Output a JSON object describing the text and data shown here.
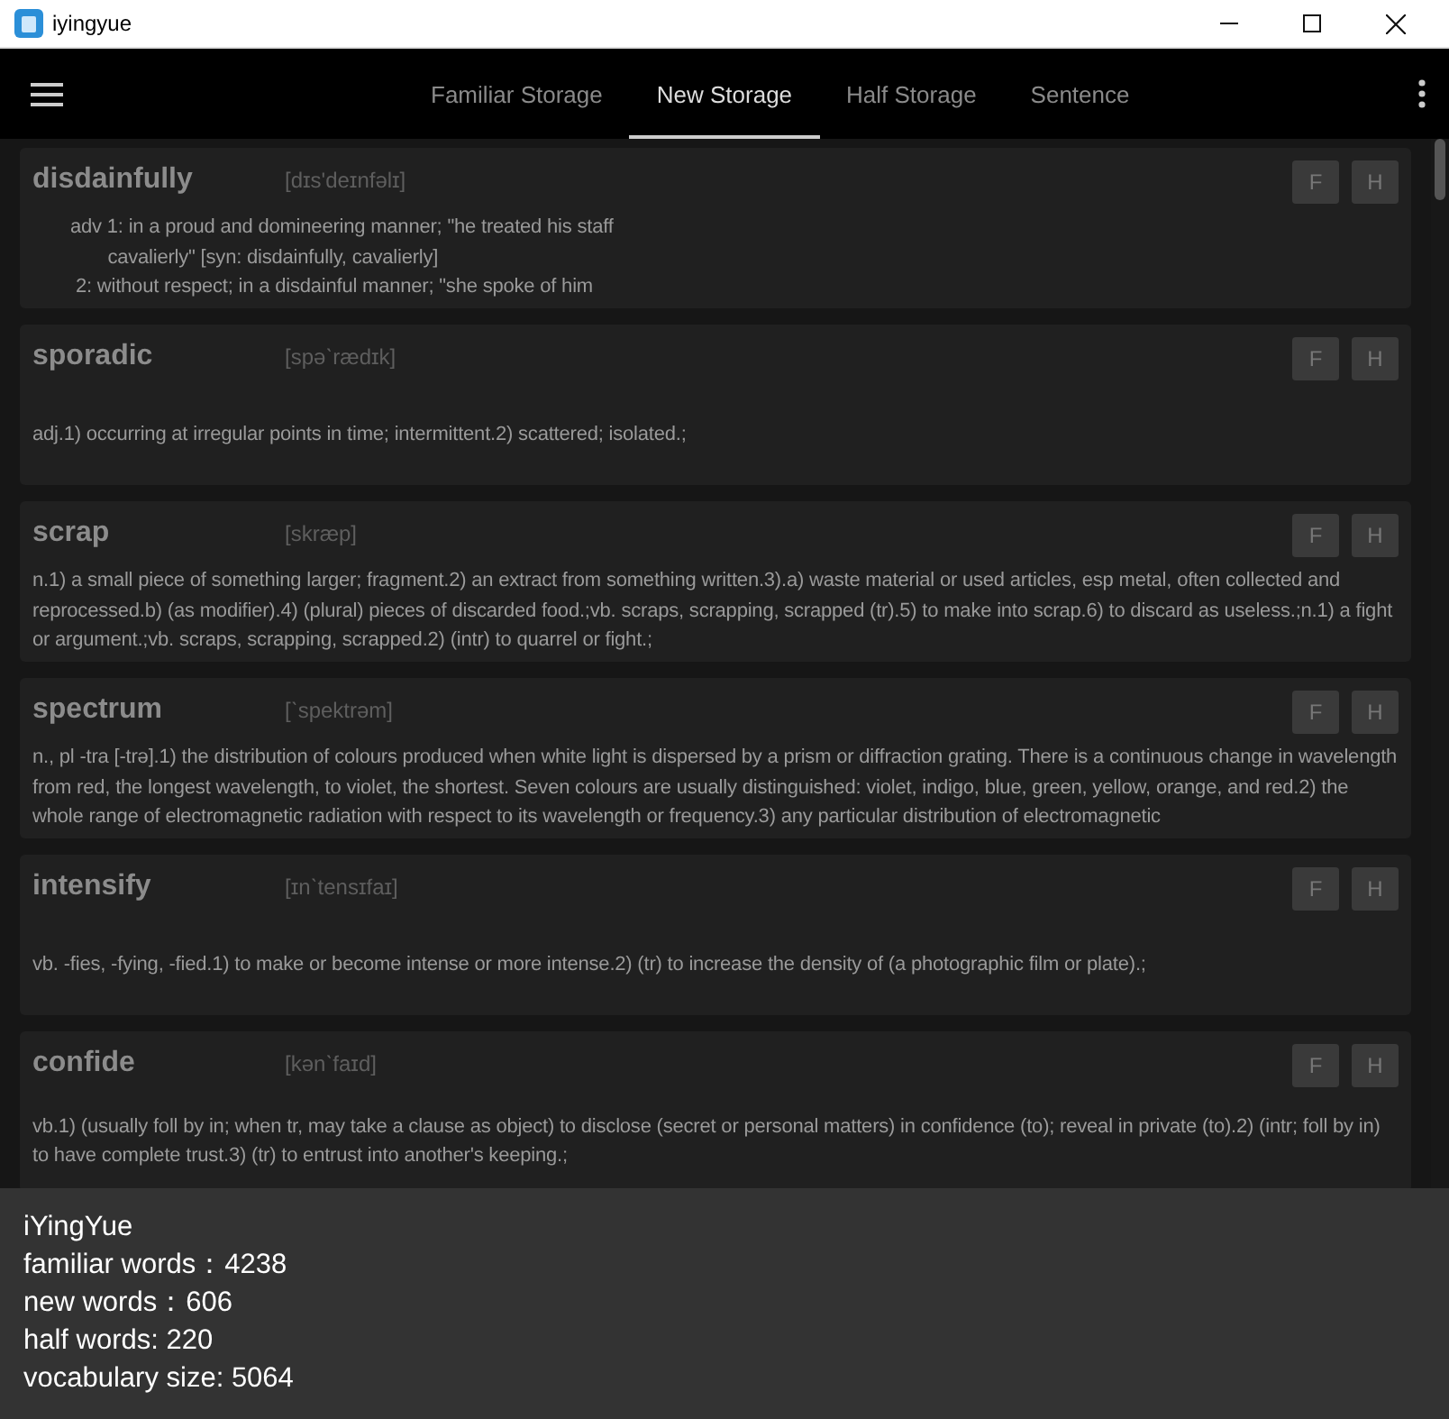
{
  "window": {
    "title": "iyingyue"
  },
  "tabs": [
    {
      "label": "Familiar Storage",
      "selected": false
    },
    {
      "label": "New Storage",
      "selected": true
    },
    {
      "label": "Half Storage",
      "selected": false
    },
    {
      "label": "Sentence",
      "selected": false
    }
  ],
  "words": [
    {
      "word": "disdainfully",
      "phonetic": "[dɪs'deɪnfəlɪ]",
      "definition": "adv 1: in a proud and domineering manner; \"he treated his staff\n       cavalierly\" [syn: disdainfully, cavalierly]\n 2: without respect; in a disdainful manner; \"she spoke of him",
      "preformatted": true,
      "buttons": [
        "F",
        "H"
      ]
    },
    {
      "word": "sporadic",
      "phonetic": "[spəˋrædɪk]",
      "definition": "adj.1) occurring at irregular points in time; intermittent.2) scattered; isolated.;",
      "preformatted": false,
      "buttons": [
        "F",
        "H"
      ]
    },
    {
      "word": "scrap",
      "phonetic": "[skræp]",
      "definition": "n.1) a small piece of something larger; fragment.2) an extract from something written.3).a) waste material or used articles, esp metal, often collected and reprocessed.b) (as modifier).4) (plural) pieces of discarded food.;vb. scraps, scrapping, scrapped (tr).5) to make into scrap.6) to discard as useless.;n.1) a fight or argument.;vb. scraps, scrapping, scrapped.2) (intr) to quarrel or fight.;",
      "preformatted": false,
      "buttons": [
        "F",
        "H"
      ]
    },
    {
      "word": "spectrum",
      "phonetic": "[ˋspektrəm]",
      "definition": "n., pl -tra [-trə].1) the distribution of colours produced when white light is dispersed by a prism or diffraction grating. There is a continuous change in wavelength from red, the longest wavelength, to violet, the shortest. Seven colours are usually distinguished: violet, indigo, blue, green, yellow, orange, and red.2) the whole range of electromagnetic radiation with respect to its wavelength or frequency.3) any particular distribution of electromagnetic",
      "preformatted": false,
      "buttons": [
        "F",
        "H"
      ]
    },
    {
      "word": "intensify",
      "phonetic": "[ɪnˋtensɪfaɪ]",
      "definition": "vb. -fies, -fying, -fied.1) to make or become intense or more intense.2) (tr) to increase the density of (a photographic film or plate).;",
      "preformatted": false,
      "buttons": [
        "F",
        "H"
      ]
    },
    {
      "word": "confide",
      "phonetic": "[kənˋfaɪd]",
      "definition": "vb.1) (usually foll by in; when tr, may take a clause as object) to disclose (secret or personal matters) in confidence (to); reveal in private (to).2) (intr; foll by in) to have complete trust.3) (tr) to entrust into another's keeping.;",
      "preformatted": false,
      "buttons": [
        "F",
        "H"
      ]
    }
  ],
  "stats": [
    "iYingYue",
    "familiar words：4238",
    "new words：606",
    "half words: 220",
    "vocabulary size: 5064"
  ]
}
